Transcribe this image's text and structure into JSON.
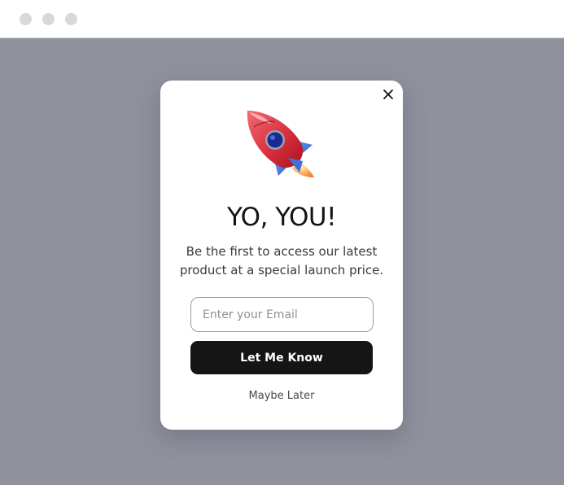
{
  "window": {
    "control_colors": [
      "#d8d8d8",
      "#d8d8d8",
      "#d8d8d8"
    ],
    "backdrop_color": "#8f929d"
  },
  "popup": {
    "illustration": "rocket-icon",
    "close_icon": "close-icon",
    "headline": "YO, YOU!",
    "subtext": "Be the first to access our latest product at a special launch price.",
    "email": {
      "placeholder": "Enter your Email",
      "value": ""
    },
    "cta_label": "Let Me Know",
    "dismiss_label": "Maybe Later",
    "cta_color": "#151515"
  }
}
